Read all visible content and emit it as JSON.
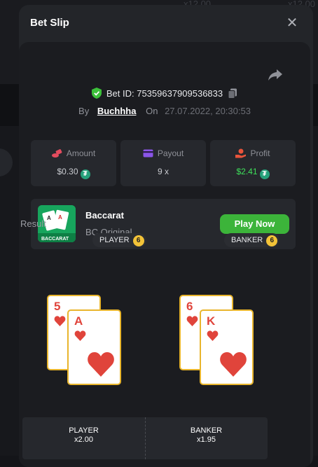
{
  "background": {
    "text_1": "x12.00",
    "text_2": "x12.00"
  },
  "modal": {
    "title": "Bet Slip",
    "close_icon": "close-icon",
    "bet_id_label": "Bet ID: 7535963790953683",
    "bet_id_suffix": "3",
    "by_label": "By",
    "username": "Buchhha",
    "on_label": "On",
    "date": "27.07.2022, 20:30:53"
  },
  "stats": {
    "amount": {
      "label": "Amount",
      "value": "$0.30",
      "icon": "coins-stack-icon"
    },
    "payout": {
      "label": "Payout",
      "value": "9 x",
      "icon": "wallet-card-icon"
    },
    "profit": {
      "label": "Profit",
      "value": "$2.41",
      "icon": "hand-coin-icon"
    },
    "currency_icon": "usdt-tether-icon",
    "currency_symbol": "₮"
  },
  "game": {
    "name": "Baccarat",
    "provider": "BC Original",
    "thumb_label": "BACCARAT",
    "play_label": "Play Now"
  },
  "result": {
    "label": "Result",
    "player": {
      "label": "PLAYER",
      "score": "6",
      "cards": [
        {
          "rank": "5",
          "suit": "hearts"
        },
        {
          "rank": "A",
          "suit": "hearts"
        }
      ]
    },
    "banker": {
      "label": "BANKER",
      "score": "6",
      "cards": [
        {
          "rank": "6",
          "suit": "hearts"
        },
        {
          "rank": "K",
          "suit": "hearts"
        }
      ]
    }
  },
  "odds": [
    {
      "name": "PLAYER",
      "multiplier": "x2.00"
    },
    {
      "name": "BANKER",
      "multiplier": "x1.95"
    }
  ],
  "colors": {
    "accent_green": "#3cb43a",
    "profit_green": "#3ee05a",
    "badge_yellow": "#f3c338",
    "card_red": "#e0443b",
    "card_border": "#e9b52c"
  }
}
